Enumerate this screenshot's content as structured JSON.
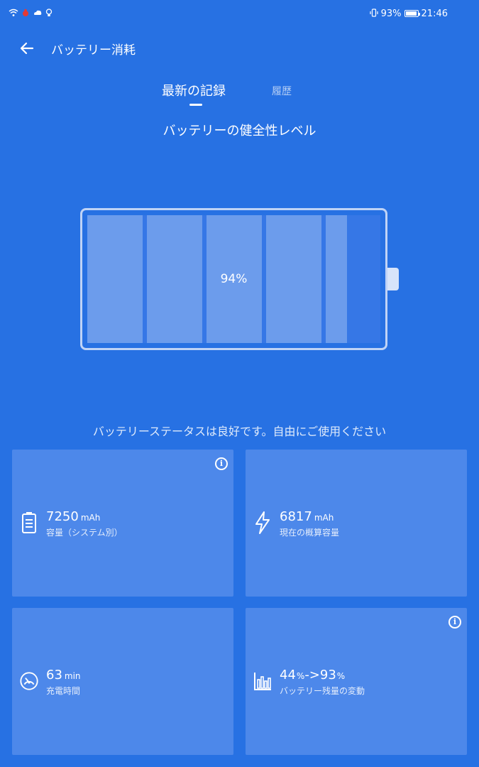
{
  "status_bar": {
    "left_icons": [
      "wifi-icon",
      "bug-icon",
      "cloud-icon",
      "lightbulb-icon"
    ],
    "battery_percent": "93%",
    "time": "21:46"
  },
  "app_bar": {
    "title": "バッテリー消耗"
  },
  "tabs": [
    {
      "label": "最新の記録",
      "active": true
    },
    {
      "label": "履歴",
      "active": false
    }
  ],
  "health": {
    "title": "バッテリーの健全性レベル",
    "level": 0.94,
    "level_text": "94%",
    "message": "バッテリーステータスは良好です。自由にご使用ください"
  },
  "cards": [
    {
      "icon": "battery-icon",
      "value": "7250",
      "unit": "mAh",
      "label": "容量（システム別）",
      "info": true
    },
    {
      "icon": "bolt-icon",
      "value": "6817",
      "unit": "mAh",
      "label": "現在の概算容量",
      "info": false
    },
    {
      "icon": "gauge-icon",
      "value": "63",
      "unit": "min",
      "label": "充電時間",
      "info": false
    },
    {
      "icon": "bar-chart-icon",
      "value_a": "44",
      "unit_a": "%",
      "arrow": "->",
      "value_b": "93",
      "unit_b": "%",
      "label": "バッテリー残量の変動",
      "info": true
    }
  ],
  "colors": {
    "background": "#2771E3",
    "card": "#4D88EA",
    "battery_cell": "#6C9CEC"
  }
}
